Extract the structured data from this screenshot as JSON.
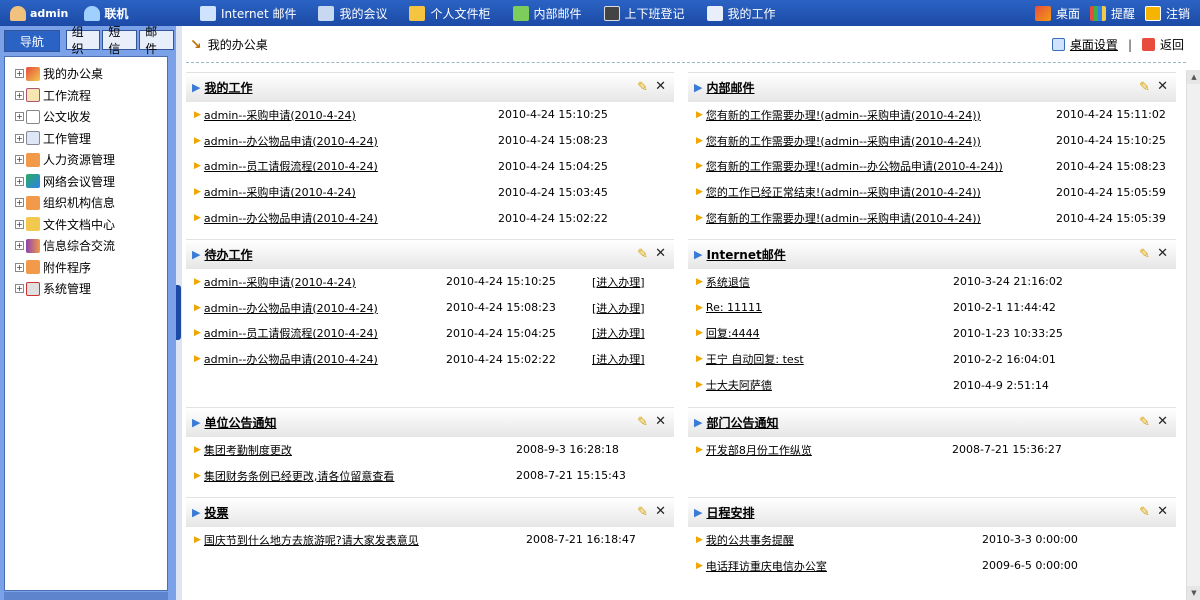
{
  "topbar": {
    "user": "admin",
    "status": "联机",
    "nav": [
      "Internet 邮件",
      "我的会议",
      "个人文件柜",
      "内部邮件",
      "上下班登记",
      "我的工作"
    ],
    "right": [
      "桌面",
      "提醒",
      "注销"
    ]
  },
  "sidebar": {
    "tabs": [
      "导航",
      "组织",
      "短信",
      "邮件"
    ],
    "tree": [
      "我的办公桌",
      "工作流程",
      "公文收发",
      "工作管理",
      "人力资源管理",
      "网络会议管理",
      "组织机构信息",
      "文件文档中心",
      "信息综合交流",
      "附件程序",
      "系统管理"
    ]
  },
  "main": {
    "breadcrumb": "我的办公桌",
    "desk_settings": "桌面设置",
    "back": "返回"
  },
  "panels": {
    "work": {
      "title": "我的工作",
      "rows": [
        {
          "t": "admin--采购申请(2010-4-24)",
          "d": "2010-4-24 15:10:25"
        },
        {
          "t": "admin--办公物品申请(2010-4-24)",
          "d": "2010-4-24 15:08:23"
        },
        {
          "t": "admin--员工请假流程(2010-4-24)",
          "d": "2010-4-24 15:04:25"
        },
        {
          "t": "admin--采购申请(2010-4-24)",
          "d": "2010-4-24 15:03:45"
        },
        {
          "t": "admin--办公物品申请(2010-4-24)",
          "d": "2010-4-24 15:02:22"
        }
      ]
    },
    "mail": {
      "title": "内部邮件",
      "rows": [
        {
          "t": "您有新的工作需要办理!(admin--采购申请(2010-4-24))",
          "d": "2010-4-24 15:11:02"
        },
        {
          "t": "您有新的工作需要办理!(admin--采购申请(2010-4-24))",
          "d": "2010-4-24 15:10:25"
        },
        {
          "t": "您有新的工作需要办理!(admin--办公物品申请(2010-4-24))",
          "d": "2010-4-24 15:08:23"
        },
        {
          "t": "您的工作已经正常结束!(admin--采购申请(2010-4-24))",
          "d": "2010-4-24 15:05:59"
        },
        {
          "t": "您有新的工作需要办理!(admin--采购申请(2010-4-24))",
          "d": "2010-4-24 15:05:39"
        }
      ]
    },
    "todo": {
      "title": "待办工作",
      "rows": [
        {
          "t": "admin--采购申请(2010-4-24)",
          "d": "2010-4-24 15:10:25",
          "op": "[进入办理]"
        },
        {
          "t": "admin--办公物品申请(2010-4-24)",
          "d": "2010-4-24 15:08:23",
          "op": "[进入办理]"
        },
        {
          "t": "admin--员工请假流程(2010-4-24)",
          "d": "2010-4-24 15:04:25",
          "op": "[进入办理]"
        },
        {
          "t": "admin--办公物品申请(2010-4-24)",
          "d": "2010-4-24 15:02:22",
          "op": "[进入办理]"
        }
      ]
    },
    "internet": {
      "title": "Internet邮件",
      "rows": [
        {
          "t": "系统退信",
          "d": "2010-3-24 21:16:02"
        },
        {
          "t": "Re: 11111",
          "d": "2010-2-1 11:44:42"
        },
        {
          "t": "回复:4444",
          "d": "2010-1-23 10:33:25"
        },
        {
          "t": "王宁 自动回复: test",
          "d": "2010-2-2 16:04:01"
        },
        {
          "t": "士大夫阿萨德",
          "d": "2010-4-9 2:51:14"
        }
      ]
    },
    "unit_notice": {
      "title": "单位公告通知",
      "rows": [
        {
          "t": "集团考勤制度更改",
          "d": "2008-9-3 16:28:18"
        },
        {
          "t": "集团财务条例已经更改,请各位留意查看",
          "d": "2008-7-21 15:15:43"
        }
      ]
    },
    "dept_notice": {
      "title": "部门公告通知",
      "rows": [
        {
          "t": "开发部8月份工作纵览",
          "d": "2008-7-21 15:36:27"
        }
      ]
    },
    "vote": {
      "title": "投票",
      "rows": [
        {
          "t": "国庆节到什么地方去旅游呢?请大家发表意见",
          "d": "2008-7-21 16:18:47"
        }
      ]
    },
    "schedule": {
      "title": "日程安排",
      "rows": [
        {
          "t": "我的公共事务提醒",
          "d": "2010-3-3 0:00:00"
        },
        {
          "t": "电话拜访重庆电信办公室",
          "d": "2009-6-5 0:00:00"
        }
      ]
    }
  }
}
